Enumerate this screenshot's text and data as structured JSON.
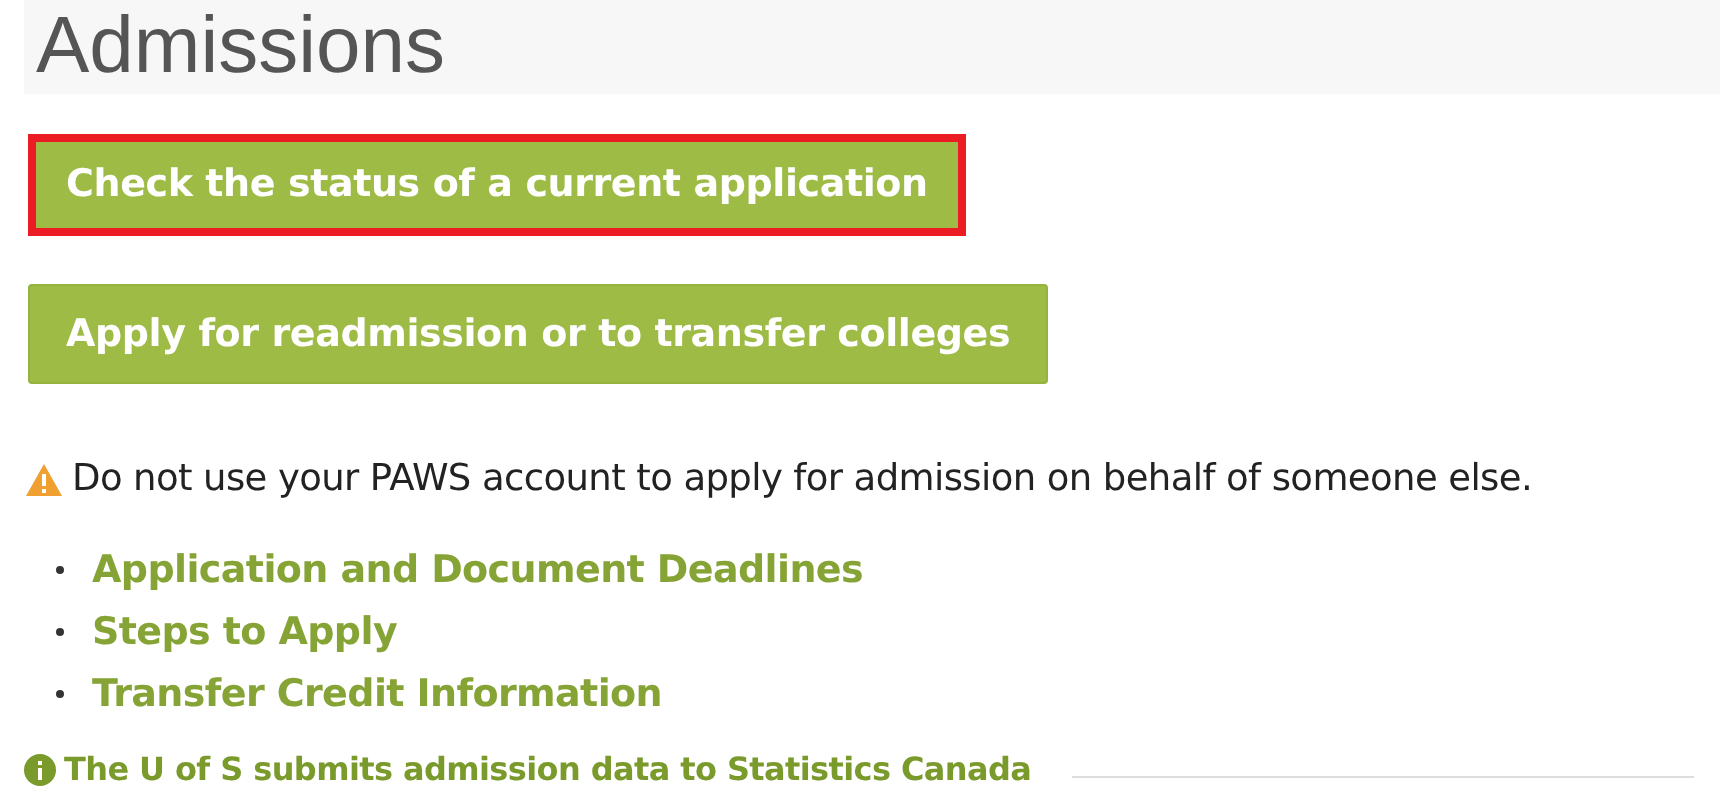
{
  "title": "Admissions",
  "buttons": [
    {
      "label": "Check the status of a current application",
      "highlighted": true
    },
    {
      "label": "Apply for readmission or to transfer colleges",
      "highlighted": false
    }
  ],
  "warning": {
    "text": "Do not use your PAWS account to apply for admission on behalf of someone else."
  },
  "links": [
    "Application and Document Deadlines",
    "Steps to Apply",
    "Transfer Credit Information"
  ],
  "info_link": {
    "text": "The U of S submits admission data to Statistics Canada"
  }
}
